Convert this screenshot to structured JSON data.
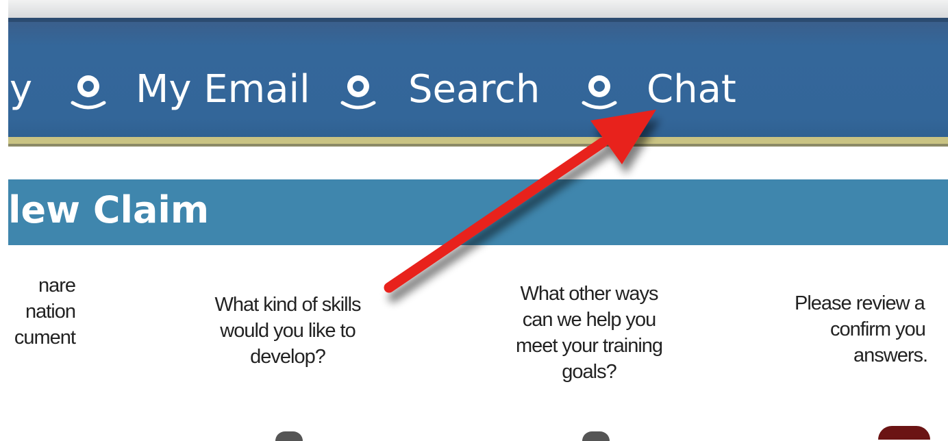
{
  "nav": {
    "items": [
      {
        "label": "y"
      },
      {
        "label": "My Email"
      },
      {
        "label": "Search"
      },
      {
        "label": "Chat"
      }
    ]
  },
  "section": {
    "title": "lew Claim"
  },
  "steps": [
    {
      "lines": [
        "nare",
        "nation",
        "cument"
      ]
    },
    {
      "lines": [
        "What kind of skills",
        "would you like to",
        "develop?"
      ]
    },
    {
      "lines": [
        "What other ways",
        "can we help you",
        "meet your training",
        "goals?"
      ]
    },
    {
      "lines": [
        "Please review a",
        "confirm you",
        "answers."
      ]
    }
  ],
  "colors": {
    "nav_bg": "#336699",
    "section_bg": "#3f86ad",
    "arrow": "#e8201c"
  },
  "icons": [
    "user-icon",
    "arrow-annotation"
  ]
}
